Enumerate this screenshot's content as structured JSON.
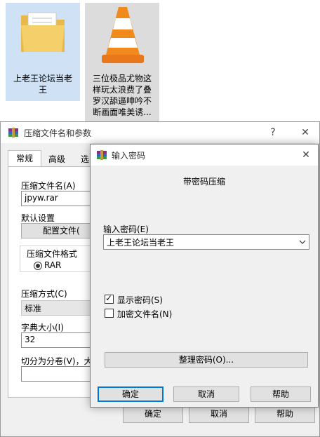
{
  "desktop": {
    "folder": {
      "label": "上老王论坛当老王"
    },
    "vlc_file": {
      "label": "三位极品尤物这样玩太浪费了叠罗汉舔逼呻吟不断画面唯美诱..."
    }
  },
  "archive_dialog": {
    "title": "压缩文件名和参数",
    "help_glyph": "?",
    "close_glyph": "✕",
    "tabs": [
      "常规",
      "高级",
      "选"
    ],
    "archive_name_label": "压缩文件名(A)",
    "archive_name_value": "jpyw.rar",
    "default_settings_label": "默认设置",
    "profiles_button": "配置文件(",
    "format_group_label": "压缩文件格式",
    "format_rar": "RAR",
    "method_label": "压缩方式(C)",
    "method_value": "标准",
    "dict_label": "字典大小(I)",
    "dict_value": "32",
    "split_label": "切分为分卷(V)，大小",
    "ok_button": "确定",
    "cancel_button": "取消",
    "help_button": "帮助"
  },
  "password_dialog": {
    "title": "输入密码",
    "close_glyph": "✕",
    "heading": "带密码压缩",
    "enter_password_label": "输入密码(E)",
    "password_value": "上老王论坛当老王",
    "show_password_label": "显示密码(S)",
    "encrypt_names_label": "加密文件名(N)",
    "organize_button": "整理密码(O)...",
    "ok_button": "确定",
    "cancel_button": "取消",
    "help_button": "帮助"
  }
}
